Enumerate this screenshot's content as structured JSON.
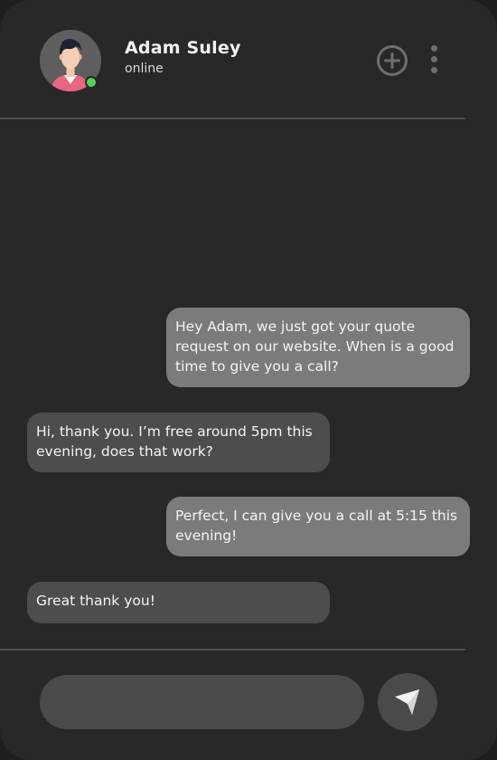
{
  "header": {
    "contact_name": "Adam Suley",
    "status": "online",
    "status_color": "#54d35a",
    "add_icon": "plus-circle-icon",
    "menu_icon": "vertical-dots-icon"
  },
  "messages": [
    {
      "direction": "outgoing",
      "lines": [
        "Hey Adam, we just got your quote",
        "request on our website. When is a good",
        "time to give you a call?"
      ]
    },
    {
      "direction": "incoming",
      "lines": [
        "Hi, thank you. I’m free around 5pm this",
        "evening, does that work?"
      ]
    },
    {
      "direction": "outgoing",
      "lines": [
        "Perfect, I can give you a call at 5:15 this",
        "evening!"
      ]
    },
    {
      "direction": "incoming",
      "lines": [
        "Great thank you!"
      ]
    }
  ],
  "composer": {
    "placeholder": "",
    "send_icon": "paper-plane-icon"
  },
  "colors": {
    "background": "#282828",
    "outgoing_bubble": "#7b7b7b",
    "incoming_bubble": "#4d4d4d"
  }
}
